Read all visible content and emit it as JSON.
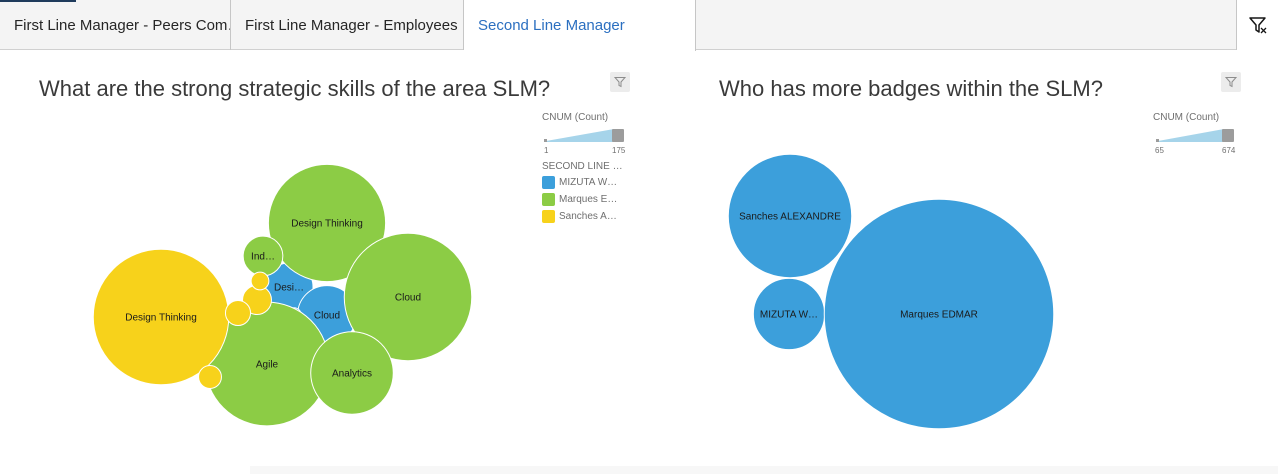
{
  "tabs": [
    {
      "label": "First Line Manager - Peers Com…"
    },
    {
      "label": "First Line Manager - Employees …"
    },
    {
      "label": "Second Line Manager"
    }
  ],
  "panels": [
    {
      "title": "What are the strong strategic skills of the area SLM?",
      "size_legend": {
        "title": "CNUM (Count)",
        "min": "1",
        "max": "175"
      },
      "color_legend": {
        "title": "SECOND LINE …",
        "items": [
          {
            "label": "MIZUTA W…",
            "color": "#3c9fdb"
          },
          {
            "label": "Marques E…",
            "color": "#8ccc45"
          },
          {
            "label": "Sanches A…",
            "color": "#f7d21b"
          }
        ]
      }
    },
    {
      "title": "Who has more badges within the SLM?",
      "size_legend": {
        "title": "CNUM (Count)",
        "min": "65",
        "max": "674"
      }
    }
  ],
  "chart_data": [
    {
      "type": "bubble",
      "size_measure": "CNUM (Count)",
      "color_by": "SECOND LINE …",
      "series": [
        {
          "name": "MIZUTA W…",
          "color": "#3c9fdb",
          "points": [
            {
              "label": "Desi…",
              "value": 22
            },
            {
              "label": "Cloud",
              "value": 33
            },
            {
              "label": "",
              "value": 2
            },
            {
              "label": "",
              "value": 2
            }
          ]
        },
        {
          "name": "Marques E…",
          "color": "#8ccc45",
          "points": [
            {
              "label": "Design Thinking",
              "value": 131
            },
            {
              "label": "Ind…",
              "value": 15
            },
            {
              "label": "Cloud",
              "value": 155
            },
            {
              "label": "Agile",
              "value": 146
            },
            {
              "label": "Analytics",
              "value": 65
            }
          ]
        },
        {
          "name": "Sanches A…",
          "color": "#f7d21b",
          "points": [
            {
              "label": "Design Thinking",
              "value": 175
            },
            {
              "label": "",
              "value": 8
            },
            {
              "label": "",
              "value": 6
            },
            {
              "label": "",
              "value": 5
            },
            {
              "label": "",
              "value": 3
            }
          ]
        }
      ]
    },
    {
      "type": "bubble",
      "size_measure": "CNUM (Count)",
      "series": [
        {
          "name": "",
          "color": "#3c9fdb",
          "points": [
            {
              "label": "Sanches ALEXANDRE",
              "value": 195
            },
            {
              "label": "MIZUTA W…",
              "value": 65
            },
            {
              "label": "Marques EDMAR",
              "value": 674
            }
          ]
        }
      ]
    }
  ]
}
